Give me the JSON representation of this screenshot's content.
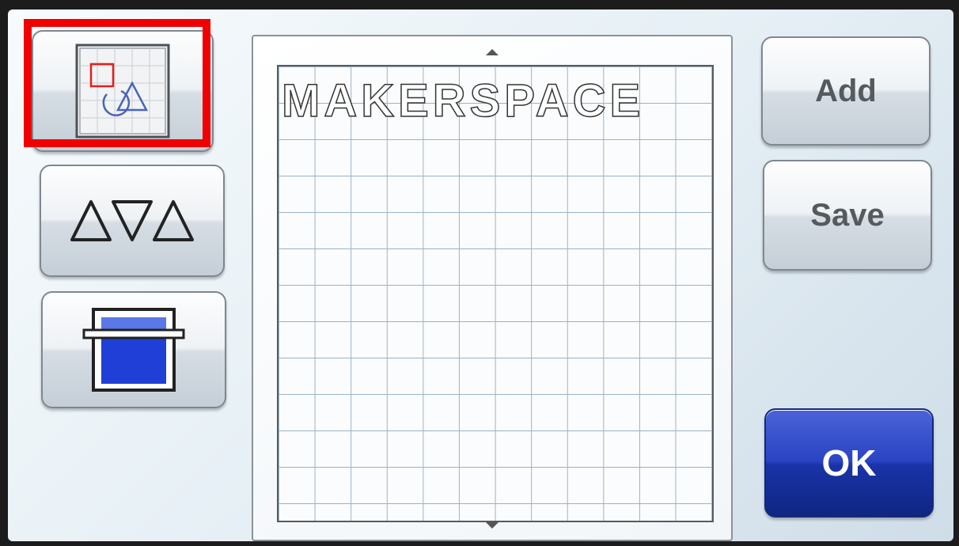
{
  "sidebar": {
    "items": [
      {
        "name": "shapes-layout-button",
        "icon": "shapes-on-grid-icon"
      },
      {
        "name": "pattern-select-button",
        "icon": "triangle-pattern-icon"
      },
      {
        "name": "mat-feed-button",
        "icon": "mat-feed-icon"
      }
    ],
    "highlight_color": "#f00000"
  },
  "mat": {
    "design_text": "MAKERSPACE",
    "scroll_up_icon": "triangle-up-icon",
    "scroll_down_icon": "triangle-down-icon"
  },
  "actions": {
    "add_label": "Add",
    "save_label": "Save",
    "ok_label": "OK"
  },
  "colors": {
    "ok_blue": "#1a33a8",
    "accent_red": "#e02020"
  }
}
